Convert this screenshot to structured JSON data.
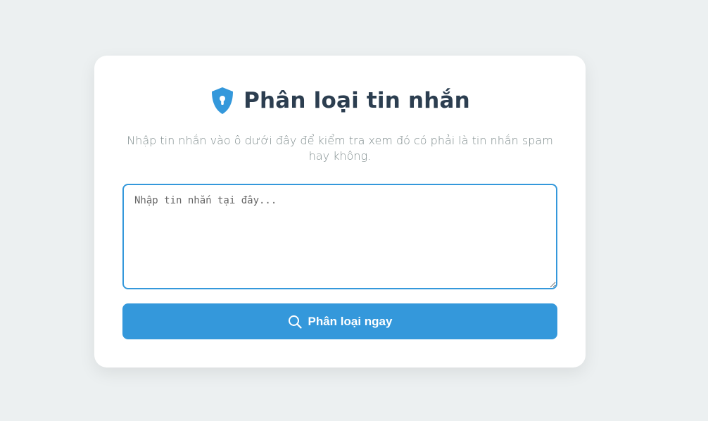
{
  "header": {
    "title": "Phân loại tin nhắn",
    "icon": "shield-keyhole-icon",
    "icon_color": "#3498db"
  },
  "subtitle": "Nhập tin nhắn vào ô dưới đây để kiểm tra xem đó có phải là tin nhắn spam hay không.",
  "input": {
    "value": "",
    "placeholder": "Nhập tin nhắn tại đây..."
  },
  "submit": {
    "label": "Phân loại ngay",
    "icon": "search-icon",
    "color": "#3498db"
  },
  "colors": {
    "background": "#ecf0f1",
    "card": "#ffffff",
    "title": "#2c3e50",
    "subtitle": "#7f8c8d",
    "accent": "#3498db"
  }
}
